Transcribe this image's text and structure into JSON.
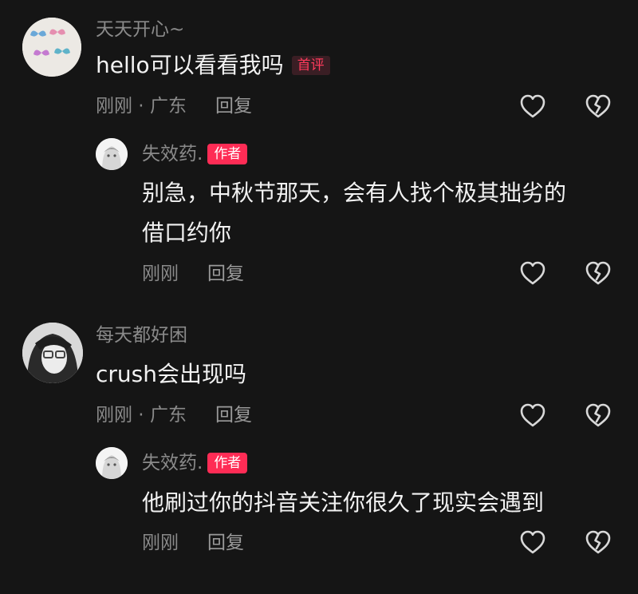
{
  "colors": {
    "background": "#151515",
    "accent": "#fe2c55",
    "muted": "#8a8a8a"
  },
  "comments": [
    {
      "username": "天天开心~",
      "text": "hello可以看看我吗",
      "badge": "首评",
      "time": "刚刚",
      "location": "广东",
      "reply_label": "回复",
      "like_icon": "heart-outline-icon",
      "dislike_icon": "broken-heart-icon"
    },
    {
      "username": "失效药.",
      "badge": "作者",
      "text_line1": "别急，中秋节那天，会有人找个极其拙劣的",
      "text_line2": "借口约你",
      "time": "刚刚",
      "reply_label": "回复"
    },
    {
      "username": "每天都好困",
      "text": "crush会出现吗",
      "time": "刚刚",
      "location": "广东",
      "reply_label": "回复"
    },
    {
      "username": "失效药.",
      "badge": "作者",
      "text": "他刷过你的抖音关注你很久了现实会遇到",
      "time": "刚刚",
      "reply_label": "回复"
    }
  ]
}
